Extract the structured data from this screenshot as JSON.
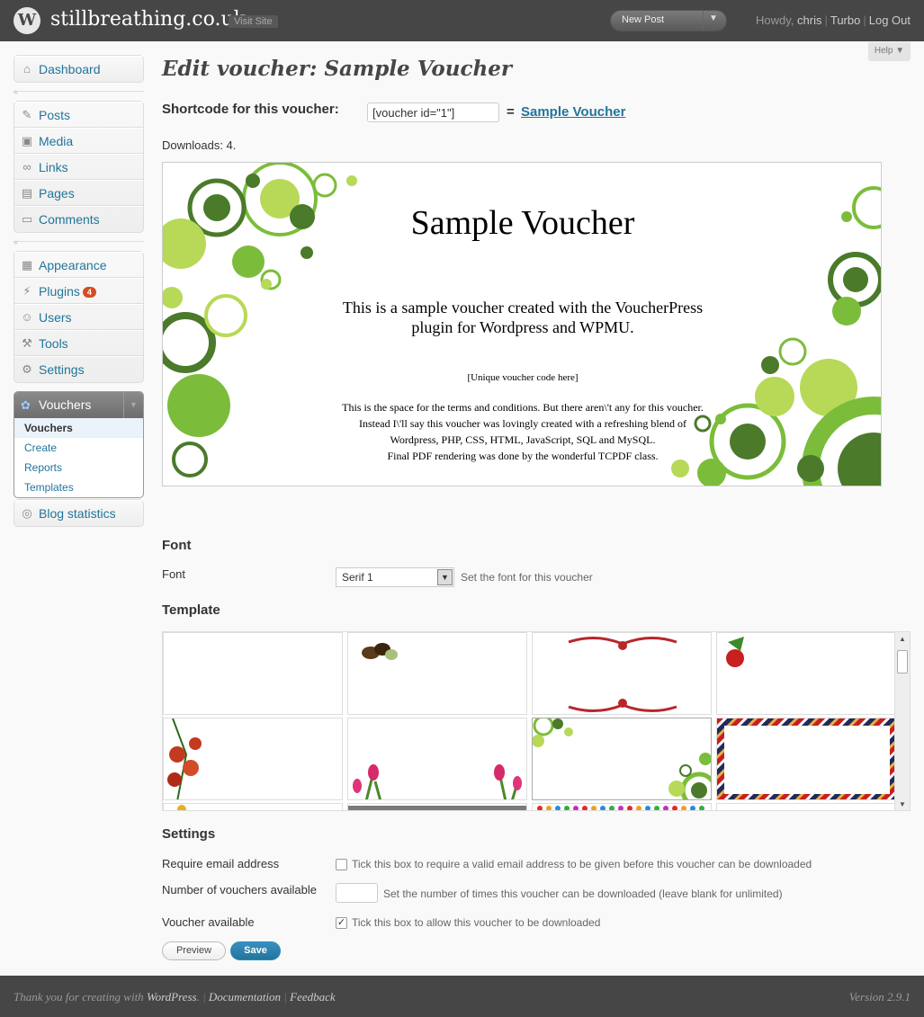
{
  "header": {
    "site_title": "stillbreathing.co.uk",
    "visit_site": "Visit Site",
    "new_post": "New Post",
    "howdy": "Howdy, ",
    "user": "chris",
    "turbo": "Turbo",
    "logout": "Log Out"
  },
  "help": "Help",
  "menu": {
    "dashboard": "Dashboard",
    "posts": "Posts",
    "media": "Media",
    "links": "Links",
    "pages": "Pages",
    "comments": "Comments",
    "appearance": "Appearance",
    "plugins": "Plugins",
    "plugins_badge": "4",
    "users": "Users",
    "tools": "Tools",
    "settings": "Settings",
    "vouchers": "Vouchers",
    "vouchers_sub": [
      "Vouchers",
      "Create",
      "Reports",
      "Templates"
    ],
    "blog_statistics": "Blog statistics"
  },
  "page": {
    "title": "Edit voucher: Sample Voucher",
    "shortcode_label": "Shortcode for this voucher:",
    "shortcode_value": "[voucher id=\"1\"]",
    "equals": "=",
    "voucher_link": "Sample Voucher",
    "downloads": "Downloads: 4."
  },
  "voucher": {
    "title": "Sample Voucher",
    "body_1": "This is a sample voucher created with the VoucherPress",
    "body_2": "plugin for Wordpress and WPMU.",
    "code": "[Unique voucher code here]",
    "terms_1": "This is the space for the terms and conditions. But there aren\\'t any for this voucher.",
    "terms_2": "Instead I\\'ll say this voucher was lovingly created with a refreshing blend of",
    "terms_3": "Wordpress, PHP, CSS, HTML, JavaScript, SQL and MySQL.",
    "terms_4": "Final PDF rendering was done by the wonderful TCPDF class."
  },
  "font_section": {
    "heading": "Font",
    "label": "Font",
    "selected": "Serif 1",
    "description": "Set the font for this voucher"
  },
  "template_section": {
    "heading": "Template"
  },
  "settings_section": {
    "heading": "Settings",
    "email_label": "Require email address",
    "email_desc": "Tick this box to require a valid email address to be given before this voucher can be downloaded",
    "email_checked": false,
    "count_label": "Number of vouchers available",
    "count_value": "",
    "count_desc": "Set the number of times this voucher can be downloaded (leave blank for unlimited)",
    "available_label": "Voucher available",
    "available_desc": "Tick this box to allow this voucher to be downloaded",
    "available_checked": true
  },
  "buttons": {
    "preview": "Preview",
    "save": "Save"
  },
  "footer": {
    "thanks_prefix": "Thank you for creating with ",
    "wordpress": "WordPress",
    "documentation": "Documentation",
    "feedback": "Feedback",
    "version": "Version 2.9.1"
  },
  "colors": {
    "accent": "#21759b",
    "header_bg": "#464646",
    "voucher_green_dark": "#4a7a2a",
    "voucher_green_light": "#b7d957"
  }
}
